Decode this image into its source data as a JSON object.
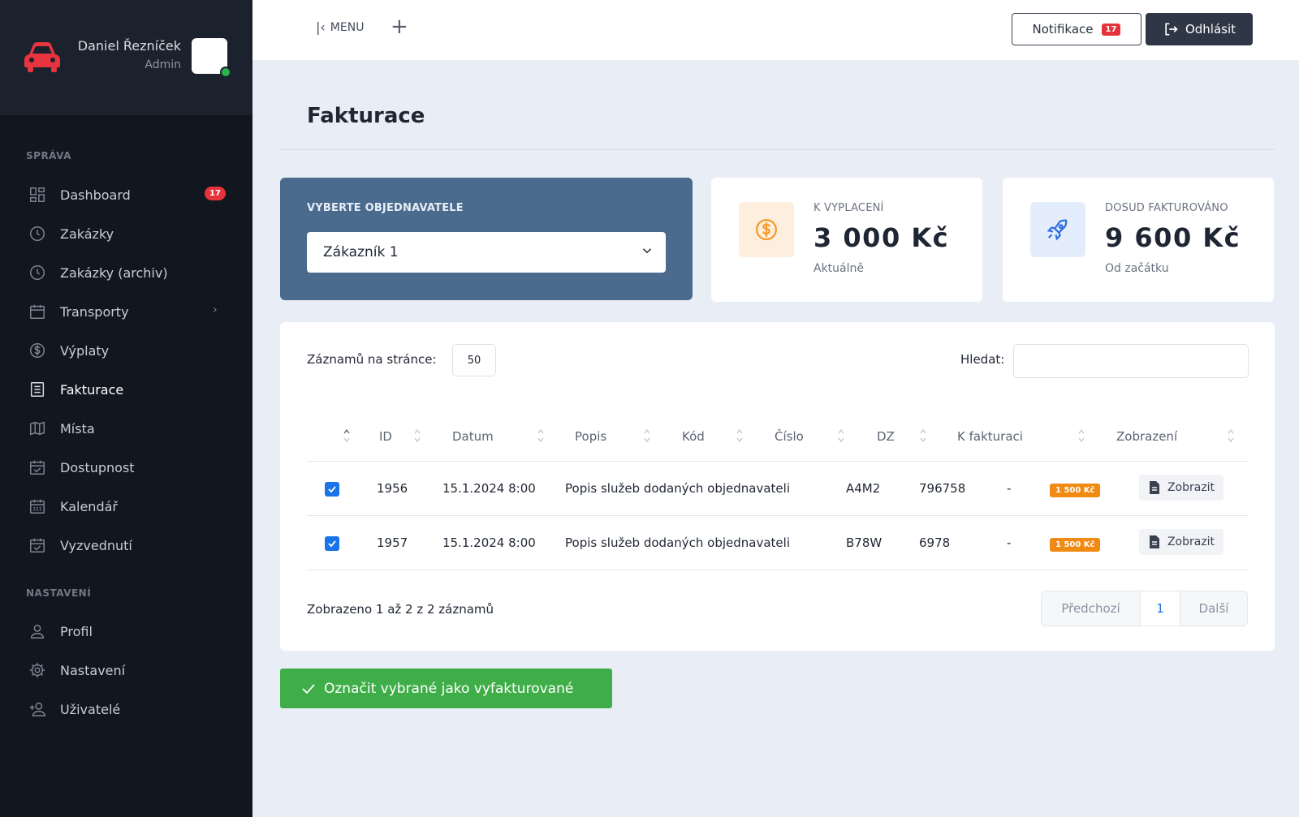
{
  "user": {
    "name": "Daniel Řezníček",
    "role": "Admin"
  },
  "sidebar": {
    "section_manage": "SPRÁVA",
    "section_settings": "NASTAVENÍ",
    "items": [
      {
        "label": "Dashboard",
        "icon": "dashboard-icon",
        "badge": "17"
      },
      {
        "label": "Zakázky",
        "icon": "clock-icon"
      },
      {
        "label": "Zakázky (archiv)",
        "icon": "clock-icon"
      },
      {
        "label": "Transporty",
        "icon": "calendar-icon"
      },
      {
        "label": "Výplaty",
        "icon": "dollar-circle-icon"
      },
      {
        "label": "Fakturace",
        "icon": "document-icon",
        "active": true
      },
      {
        "label": "Místa",
        "icon": "map-icon"
      },
      {
        "label": "Dostupnost",
        "icon": "calendar-check-icon"
      },
      {
        "label": "Kalendář",
        "icon": "calendar-grid-icon"
      },
      {
        "label": "Vyzvednutí",
        "icon": "calendar-check-icon"
      },
      {
        "label": "Profil",
        "icon": "user-icon"
      },
      {
        "label": "Nastavení",
        "icon": "gear-icon"
      },
      {
        "label": "Uživatelé",
        "icon": "user-add-icon"
      }
    ]
  },
  "topbar": {
    "menu_label": "MENU",
    "notifications_label": "Notifikace",
    "notifications_count": "17",
    "logout_label": "Odhlásit"
  },
  "page": {
    "title": "Fakturace"
  },
  "customer": {
    "label": "VYBERTE OBJEDNAVATELE",
    "selected": "Zákazník 1"
  },
  "stats": {
    "to_pay": {
      "label": "K VYPLACENÍ",
      "value": "3 000 Kč",
      "sub": "Aktuálně",
      "icon": "dollar-circle-icon",
      "color": "#f39c2b"
    },
    "invoiced": {
      "label": "DOSUD FAKTUROVÁNO",
      "value": "9 600 Kč",
      "sub": "Od začátku",
      "icon": "rocket-icon",
      "color": "#2f6fe4"
    }
  },
  "table": {
    "length_label": "Záznamů na stránce:",
    "length_value": "50",
    "search_label": "Hledat:",
    "search_value": "",
    "columns": [
      "ID",
      "Datum",
      "Popis",
      "Kód",
      "Číslo",
      "DZ",
      "K fakturaci",
      "Zobrazení"
    ],
    "rows": [
      {
        "checked": true,
        "id": "1956",
        "date": "15.1.2024 8:00",
        "desc": "Popis služeb dodaných objednavateli",
        "code": "A4M2",
        "number": "796758",
        "dz": "-",
        "amount": "1 500 Kč",
        "action": "Zobrazit"
      },
      {
        "checked": true,
        "id": "1957",
        "date": "15.1.2024 8:00",
        "desc": "Popis služeb dodaných objednavateli",
        "code": "B78W",
        "number": "6978",
        "dz": "-",
        "amount": "1 500 Kč",
        "action": "Zobrazit"
      }
    ],
    "info": "Zobrazeno 1 až 2 z 2 záznamů",
    "pager": {
      "prev": "Předchozí",
      "current": "1",
      "next": "Další"
    }
  },
  "actions": {
    "mark_invoiced": "Označit vybrané jako vyfakturované"
  },
  "colors": {
    "sidebar_bg": "#12161f",
    "customer_card": "#4a6a8e",
    "success": "#3fae49",
    "accent": "#1a73e8",
    "badge_red": "#e5323b",
    "badge_orange": "#f08a12"
  }
}
